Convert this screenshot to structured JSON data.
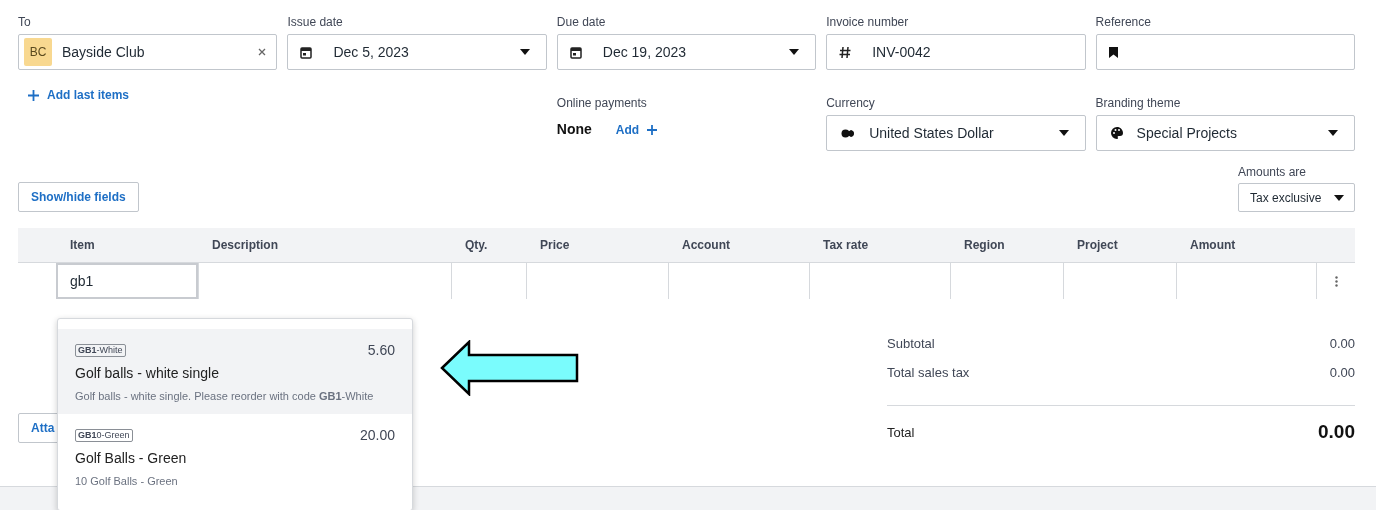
{
  "fields": [
    {
      "label": "To",
      "kind": "contact",
      "avatar": "BC",
      "value": "Bayside Club"
    },
    {
      "label": "Issue date",
      "kind": "date",
      "value": "Dec 5, 2023"
    },
    {
      "label": "Due date",
      "kind": "date",
      "value": "Dec 19, 2023"
    },
    {
      "label": "Invoice number",
      "kind": "number",
      "value": "INV-0042"
    },
    {
      "label": "Reference",
      "kind": "reference"
    }
  ],
  "add_last_items": "Add last items",
  "online_payments": {
    "label": "Online payments",
    "value": "None",
    "action": "Add"
  },
  "currency": {
    "label": "Currency",
    "value": "United States Dollar"
  },
  "branding_theme": {
    "label": "Branding theme",
    "value": "Special Projects"
  },
  "show_hide_button": "Show/hide fields",
  "amounts_are": {
    "label": "Amounts are",
    "value": "Tax exclusive"
  },
  "table": {
    "columns": [
      "Item",
      "Description",
      "Qty.",
      "Price",
      "Account",
      "Tax rate",
      "Region",
      "Project",
      "Amount"
    ],
    "row": {
      "item": "gb1"
    }
  },
  "suggestions": [
    {
      "code": "**GB1**-White",
      "price": "5.60",
      "name": "Golf balls - white single",
      "description": "Golf balls - white single. Please reorder with code **GB1**-White",
      "selected": true
    },
    {
      "code": "**GB1**0-Green",
      "price": "20.00",
      "name": "Golf Balls - Green",
      "description": "10 Golf Balls - Green",
      "selected": false
    }
  ],
  "attach_button": "Atta",
  "totals": [
    {
      "label": "Subtotal",
      "value": "0.00",
      "kind": "line"
    },
    {
      "label": "Total sales tax",
      "value": "0.00",
      "kind": "line"
    },
    {
      "label": "Total",
      "value": "0.00",
      "kind": "total"
    }
  ]
}
